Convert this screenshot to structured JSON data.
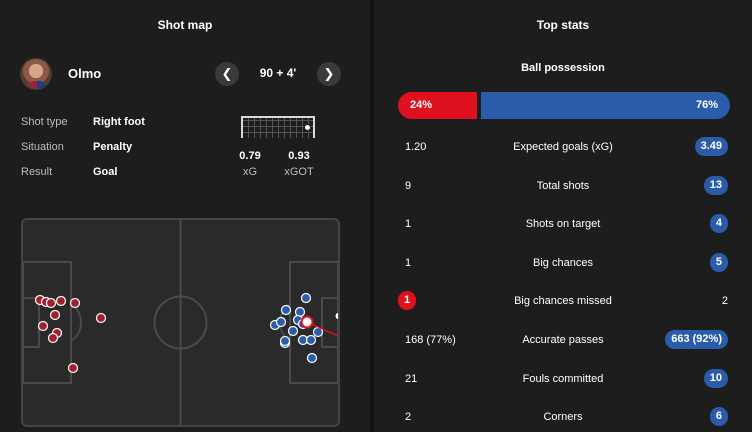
{
  "shot_map": {
    "title": "Shot map",
    "player_name": "Olmo",
    "minute": "90 + 4'",
    "prev_icon": "chevron-left-icon",
    "next_icon": "chevron-right-icon",
    "shot_type_label": "Shot type",
    "shot_type_value": "Right foot",
    "situation_label": "Situation",
    "situation_value": "Penalty",
    "result_label": "Result",
    "result_value": "Goal",
    "xg_value": "0.79",
    "xg_label": "xG",
    "xgot_value": "0.93",
    "xgot_label": "xGOT",
    "colors": {
      "home": "#a0202e",
      "away": "#2a5caa",
      "selected_line": "#e0111e"
    }
  },
  "top_stats": {
    "title": "Top stats",
    "possession": {
      "label": "Ball possession",
      "home": "24%",
      "away": "76%",
      "home_value": 24,
      "away_value": 76
    },
    "rows": [
      {
        "name": "Expected goals (xG)",
        "home": "1.20",
        "away": "3.49",
        "highlight": "away"
      },
      {
        "name": "Total shots",
        "home": "9",
        "away": "13",
        "highlight": "away"
      },
      {
        "name": "Shots on target",
        "home": "1",
        "away": "4",
        "highlight": "away"
      },
      {
        "name": "Big chances",
        "home": "1",
        "away": "5",
        "highlight": "away"
      },
      {
        "name": "Big chances missed",
        "home": "1",
        "away": "2",
        "highlight": "home"
      },
      {
        "name": "Accurate passes",
        "home": "168 (77%)",
        "away": "663 (92%)",
        "highlight": "away"
      },
      {
        "name": "Fouls committed",
        "home": "21",
        "away": "10",
        "highlight": "away"
      },
      {
        "name": "Corners",
        "home": "2",
        "away": "6",
        "highlight": "away"
      }
    ],
    "colors": {
      "home": "#e0111e",
      "away": "#2a5caa"
    }
  }
}
